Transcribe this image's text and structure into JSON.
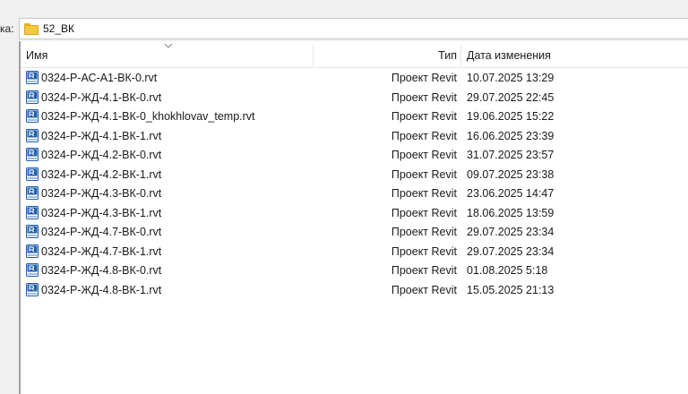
{
  "path_bar": {
    "label": "ка:",
    "folder_name": "52_ВК"
  },
  "columns": {
    "name": "Имя",
    "type": "Тип",
    "date": "Дата изменения"
  },
  "files": [
    {
      "name": "0324-Р-АС-А1-ВК-0.rvt",
      "type": "Проект Revit",
      "date": "10.07.2025 13:29"
    },
    {
      "name": "0324-Р-ЖД-4.1-ВК-0.rvt",
      "type": "Проект Revit",
      "date": "29.07.2025 22:45"
    },
    {
      "name": "0324-Р-ЖД-4.1-ВК-0_khokhlovav_temp.rvt",
      "type": "Проект Revit",
      "date": "19.06.2025 15:22"
    },
    {
      "name": "0324-Р-ЖД-4.1-ВК-1.rvt",
      "type": "Проект Revit",
      "date": "16.06.2025 23:39"
    },
    {
      "name": "0324-Р-ЖД-4.2-ВК-0.rvt",
      "type": "Проект Revit",
      "date": "31.07.2025 23:57"
    },
    {
      "name": "0324-Р-ЖД-4.2-ВК-1.rvt",
      "type": "Проект Revit",
      "date": "09.07.2025 23:38"
    },
    {
      "name": "0324-Р-ЖД-4.3-ВК-0.rvt",
      "type": "Проект Revit",
      "date": "23.06.2025 14:47"
    },
    {
      "name": "0324-Р-ЖД-4.3-ВК-1.rvt",
      "type": "Проект Revit",
      "date": "18.06.2025 13:59"
    },
    {
      "name": "0324-Р-ЖД-4.7-ВК-0.rvt",
      "type": "Проект Revit",
      "date": "29.07.2025 23:34"
    },
    {
      "name": "0324-Р-ЖД-4.7-ВК-1.rvt",
      "type": "Проект Revit",
      "date": "29.07.2025 23:34"
    },
    {
      "name": "0324-Р-ЖД-4.8-ВК-0.rvt",
      "type": "Проект Revit",
      "date": "01.08.2025 5:18"
    },
    {
      "name": "0324-Р-ЖД-4.8-ВК-1.rvt",
      "type": "Проект Revit",
      "date": "15.05.2025 21:13"
    }
  ],
  "icons": {
    "folder": "folder-icon",
    "revit_file": "revit-file-icon",
    "sort": "sort-caret-icon"
  },
  "colors": {
    "folder": "#f5c842",
    "revit_icon": "#1f5fa8"
  }
}
